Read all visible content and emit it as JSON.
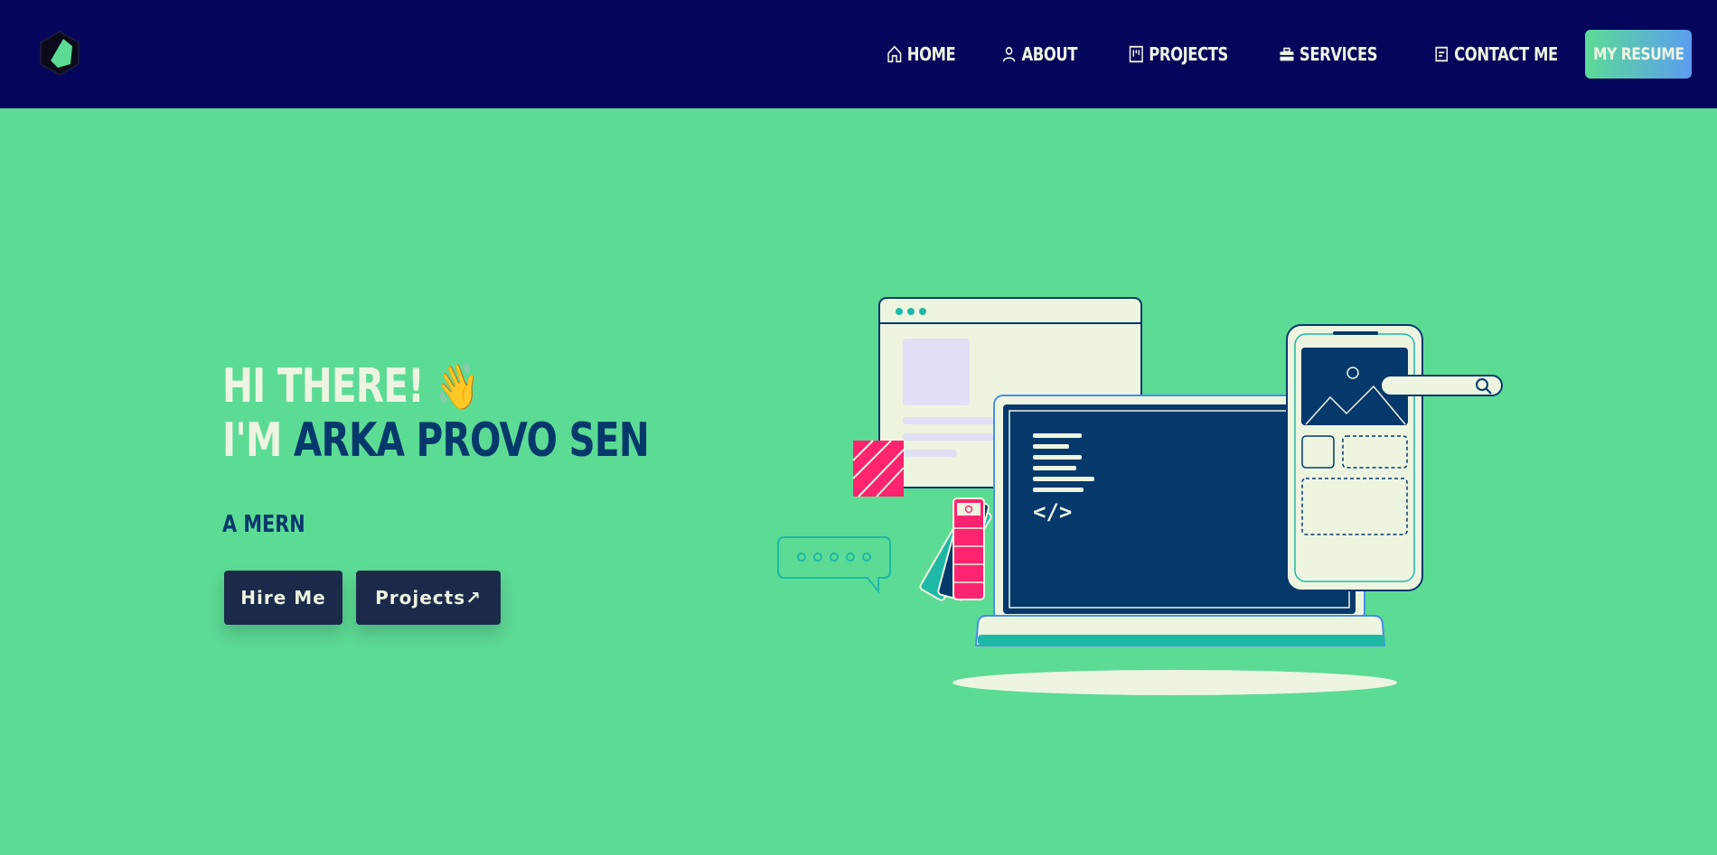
{
  "nav": {
    "items": [
      {
        "label": "Home",
        "icon": "home-icon"
      },
      {
        "label": "About",
        "icon": "user-icon"
      },
      {
        "label": "Projects",
        "icon": "kanban-icon"
      },
      {
        "label": "Services",
        "icon": "toolbox-icon"
      },
      {
        "label": "Contact Me",
        "icon": "chat-icon"
      }
    ],
    "resume_label": "MY RESUME"
  },
  "hero": {
    "greeting": "HI THERE!",
    "wave_emoji": "👋",
    "intro_prefix": "I'M",
    "name": "ARKA PROVO SEN",
    "subtitle": "A MERN",
    "hire_label": "Hire Me",
    "projects_label": "Projects↗"
  },
  "colors": {
    "background": "#5cdb95",
    "navbar": "#05055b",
    "light_text": "#edf5e1",
    "dark_text": "#05386b",
    "button": "#1b2a4a",
    "accent_pink": "#ff2470",
    "accent_teal": "#1fb8a6"
  }
}
